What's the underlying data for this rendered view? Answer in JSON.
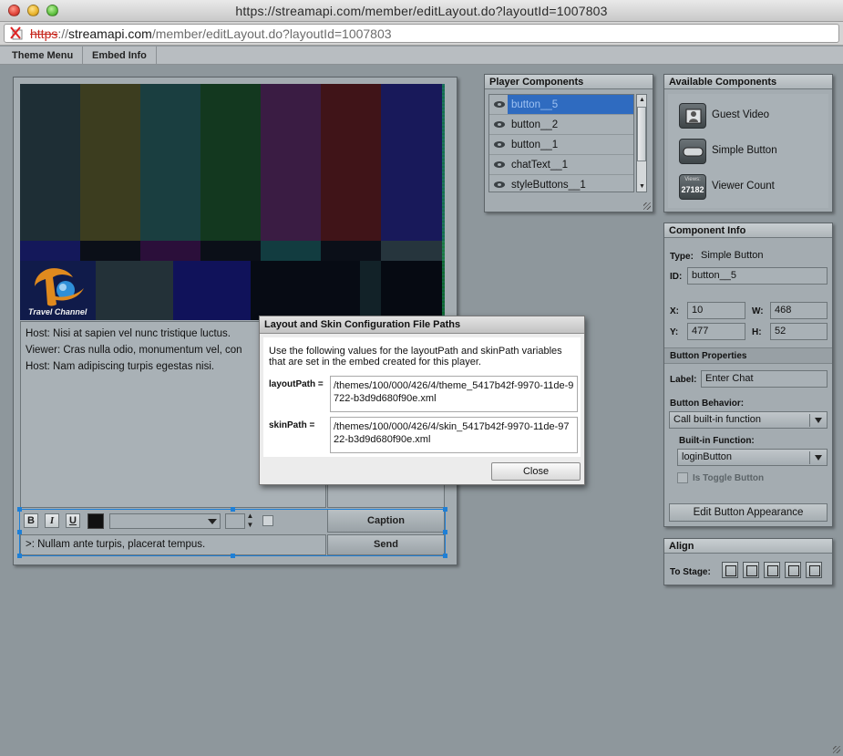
{
  "window": {
    "title": "https://streamapi.com/member/editLayout.do?layoutId=1007803"
  },
  "urlbar": {
    "scheme": "https",
    "sep": "://",
    "domain": "streamapi.com",
    "path": "/member/editLayout.do?layoutId=1007803"
  },
  "menu": {
    "items": [
      {
        "label": "Theme Menu"
      },
      {
        "label": "Embed Info"
      }
    ]
  },
  "player": {
    "logo_text": "Travel Channel",
    "chat_lines": [
      "Host: Nisi at sapien vel nunc tristique luctus. ",
      "Viewer: Cras nulla odio, monumentum vel, con",
      "Host: Nam adipiscing turpis egestas nisi."
    ],
    "caption_label": "Caption",
    "send_label": "Send",
    "message_value": ">: Nullam ante turpis, placerat tempus.",
    "toolbar": {
      "bold": "B",
      "italic": "I",
      "underline": "U"
    }
  },
  "player_components": {
    "title": "Player Components",
    "items": [
      {
        "label": "button__5",
        "selected": true
      },
      {
        "label": "button__2",
        "selected": false
      },
      {
        "label": "button__1",
        "selected": false
      },
      {
        "label": "chatText__1",
        "selected": false
      },
      {
        "label": "styleButtons__1",
        "selected": false
      }
    ]
  },
  "available_components": {
    "title": "Available Components",
    "items": [
      {
        "label": "Guest Video",
        "icon": "guest-video-icon"
      },
      {
        "label": "Simple Button",
        "icon": "simple-button-icon"
      },
      {
        "label": "Viewer Count",
        "icon": "viewer-count-icon",
        "icon_text_top": "Views:",
        "icon_text_bottom": "27182"
      }
    ]
  },
  "component_info": {
    "title": "Component Info",
    "type_label": "Type:",
    "type_value": "Simple Button",
    "id_label": "ID:",
    "id_value": "button__5",
    "x_label": "X:",
    "x_value": "10",
    "w_label": "W:",
    "w_value": "468",
    "y_label": "Y:",
    "y_value": "477",
    "h_label": "H:",
    "h_value": "52",
    "section_title": "Button Properties",
    "label_label": "Label:",
    "label_value": "Enter Chat",
    "behavior_label": "Button Behavior:",
    "behavior_value": "Call built-in function",
    "builtin_label": "Built-in Function:",
    "builtin_value": "loginButton",
    "toggle_label": "Is Toggle Button",
    "edit_button": "Edit Button Appearance"
  },
  "align": {
    "title": "Align",
    "to_stage_label": "To Stage:"
  },
  "dialog": {
    "title": "Layout and Skin Configuration File Paths",
    "description": "Use the following values for the layoutPath and skinPath variables that are set in the embed created for this player.",
    "layout_label": "layoutPath =",
    "layout_value": "/themes/100/000/426/4/theme_5417b42f-9970-11de-9722-b3d9d680f90e.xml",
    "skin_label": "skinPath =",
    "skin_value": "/themes/100/000/426/4/skin_5417b42f-9970-11de-9722-b3d9d680f90e.xml",
    "close_label": "Close"
  },
  "colors": {
    "accent": "#2f6bc0",
    "selection": "#1e7fd6",
    "background": "#8e979c"
  }
}
